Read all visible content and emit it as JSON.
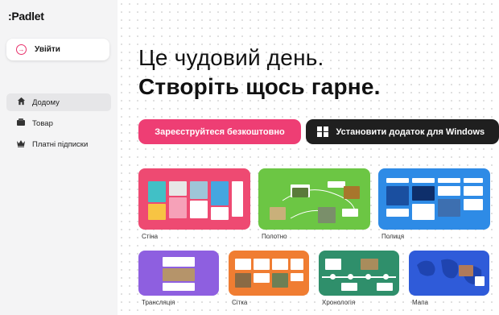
{
  "sidebar": {
    "logo": ":Padlet",
    "login_label": "Увійти",
    "nav": [
      {
        "label": "Додому",
        "icon": "home-icon",
        "active": true
      },
      {
        "label": "Товар",
        "icon": "product-icon",
        "active": false
      },
      {
        "label": "Платні підписки",
        "icon": "crown-icon",
        "active": false
      }
    ]
  },
  "hero": {
    "line1": "Це чудовий день.",
    "line2": "Створіть щось гарне."
  },
  "actions": {
    "signup_label": "Зареєструйтеся безкоштовно",
    "windows_label": "Установити додаток для Windows"
  },
  "templates": [
    {
      "label": "Стіна",
      "color": "#ee4a72"
    },
    {
      "label": "Полотно",
      "color": "#6cc644"
    },
    {
      "label": "Полиця",
      "color": "#2e8be6"
    },
    {
      "label": "Трансляція",
      "color": "#8e5fe0"
    },
    {
      "label": "Сітка",
      "color": "#f07d32"
    },
    {
      "label": "Хронологія",
      "color": "#2f8f6b"
    },
    {
      "label": "Мапа",
      "color": "#2f5bd9"
    }
  ],
  "colors": {
    "accent": "#ee3e74",
    "dark_button": "#1f1f1f",
    "sidebar_bg": "#f4f4f5"
  }
}
